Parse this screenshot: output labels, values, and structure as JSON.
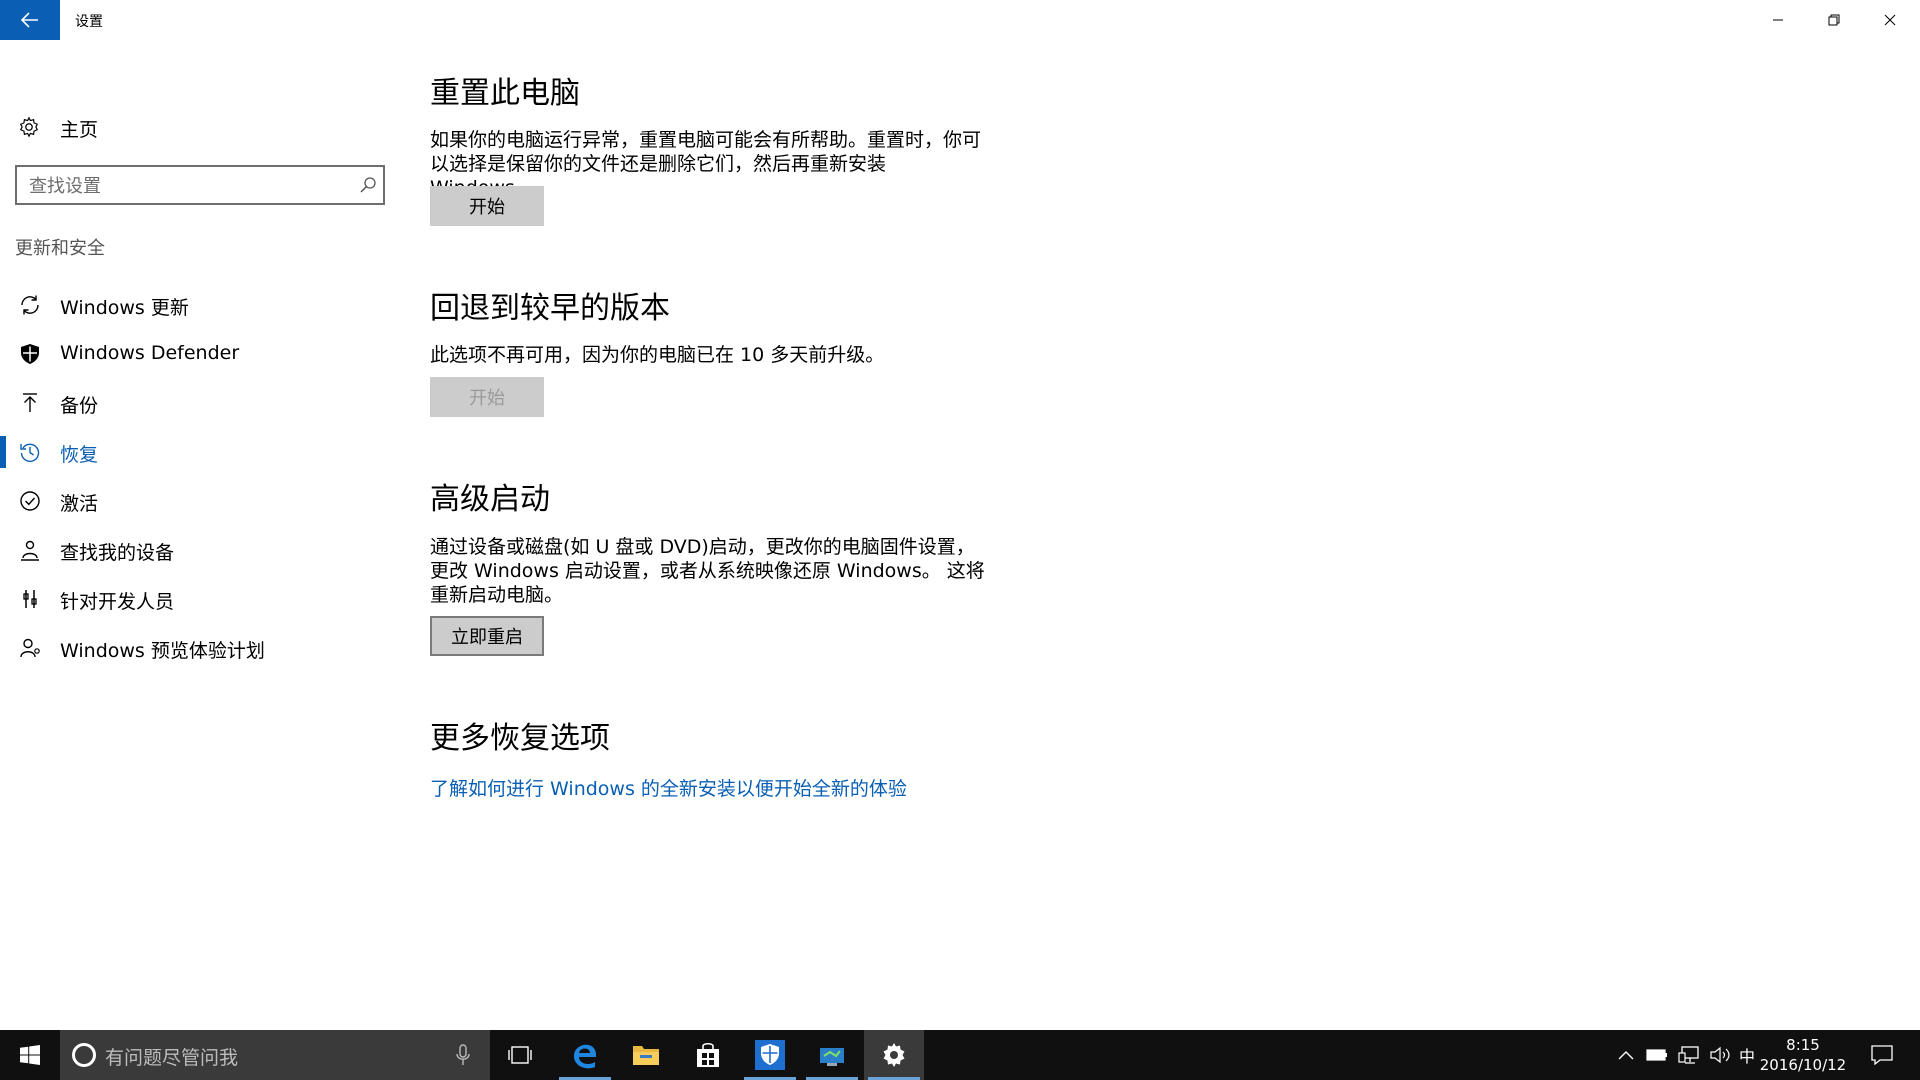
{
  "window": {
    "title": "设置"
  },
  "sidebar": {
    "home_label": "主页",
    "search_placeholder": "查找设置",
    "section_label": "更新和安全",
    "items": [
      {
        "label": "Windows 更新",
        "icon": "sync-icon"
      },
      {
        "label": "Windows Defender",
        "icon": "shield-icon"
      },
      {
        "label": "备份",
        "icon": "upload-arrow-icon"
      },
      {
        "label": "恢复",
        "icon": "history-icon",
        "active": true
      },
      {
        "label": "激活",
        "icon": "check-circle-icon"
      },
      {
        "label": "查找我的设备",
        "icon": "person-location-icon"
      },
      {
        "label": "针对开发人员",
        "icon": "developer-tools-icon"
      },
      {
        "label": "Windows 预览体验计划",
        "icon": "insider-person-icon"
      }
    ]
  },
  "main": {
    "reset": {
      "title": "重置此电脑",
      "description": "如果你的电脑运行异常，重置电脑可能会有所帮助。重置时，你可以选择是保留你的文件还是删除它们，然后再重新安装 Windows。",
      "button_label": "开始"
    },
    "rollback": {
      "title": "回退到较早的版本",
      "description": "此选项不再可用，因为你的电脑已在 10 多天前升级。",
      "button_label": "开始"
    },
    "advanced": {
      "title": "高级启动",
      "description": "通过设备或磁盘(如 U 盘或 DVD)启动，更改你的电脑固件设置，更改 Windows 启动设置，或者从系统映像还原 Windows。 这将重新启动电脑。",
      "button_label": "立即重启"
    },
    "more": {
      "title": "更多恢复选项",
      "link_text": "了解如何进行 Windows 的全新安装以便开始全新的体验"
    }
  },
  "taskbar": {
    "search_placeholder": "有问题尽管问我",
    "ime_label": "中",
    "time": "8:15",
    "date": "2016/10/12"
  },
  "colors": {
    "accent": "#0a5fb4",
    "taskbar": "#101010",
    "button": "#cccccc"
  }
}
